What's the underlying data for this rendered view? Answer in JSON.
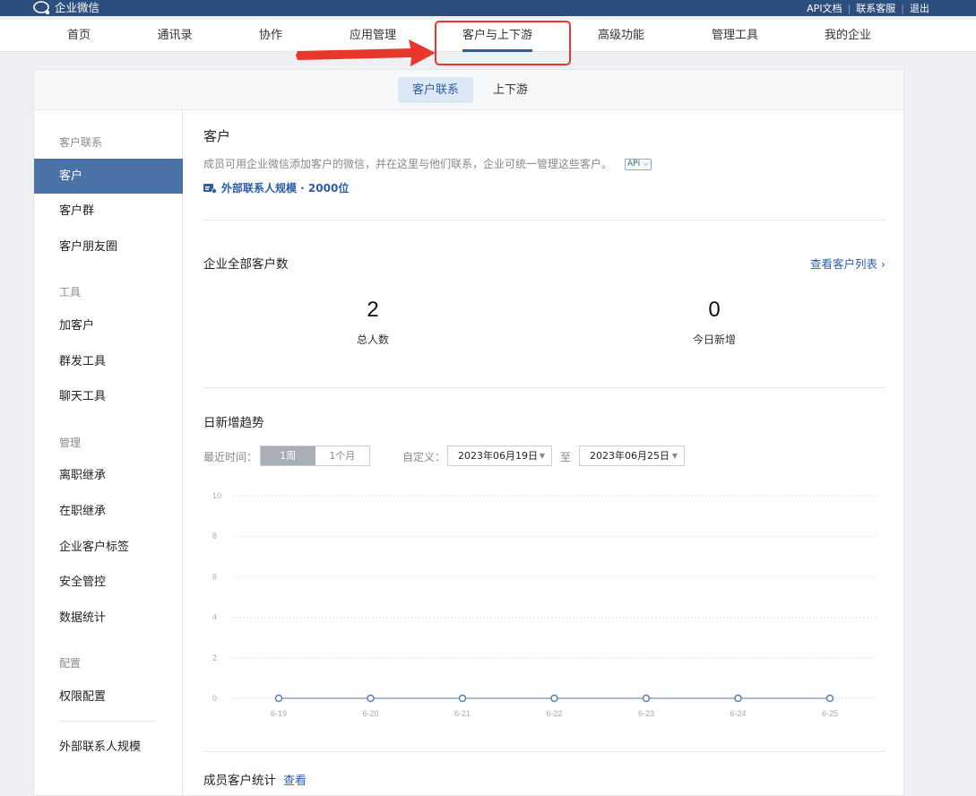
{
  "topbar": {
    "brand": "企业微信",
    "links": [
      "API文档",
      "联系客服",
      "退出"
    ]
  },
  "nav": {
    "items": [
      "首页",
      "通讯录",
      "协作",
      "应用管理",
      "客户与上下游",
      "高级功能",
      "管理工具",
      "我的企业"
    ],
    "active": "客户与上下游"
  },
  "subtabs": [
    "客户联系",
    "上下游"
  ],
  "sidebar": {
    "groups": [
      {
        "title": "客户联系",
        "items": [
          "客户",
          "客户群",
          "客户朋友圈"
        ]
      },
      {
        "title": "工具",
        "items": [
          "加客户",
          "群发工具",
          "聊天工具"
        ]
      },
      {
        "title": "管理",
        "items": [
          "离职继承",
          "在职继承",
          "企业客户标签",
          "安全管控",
          "数据统计"
        ]
      },
      {
        "title": "配置",
        "items": [
          "权限配置"
        ]
      }
    ],
    "footer_item": "外部联系人规模",
    "active": "客户"
  },
  "content": {
    "title": "客户",
    "description": "成员可用企业微信添加客户的微信，并在这里与他们联系，企业可统一管理这些客户。",
    "api_badge": "API",
    "scale_text": "外部联系人规模 · 2000位",
    "total_section_title": "企业全部客户数",
    "view_list": "查看客户列表",
    "stats": [
      {
        "value": "2",
        "label": "总人数"
      },
      {
        "value": "0",
        "label": "今日新增"
      }
    ],
    "trend_title": "日新增趋势",
    "recent_label": "最近时间：",
    "period_options": [
      "1周",
      "1个月"
    ],
    "period_selected": "1周",
    "custom_label": "自定义：",
    "date_from": "2023年06月19日",
    "to_label": "至",
    "date_to": "2023年06月25日",
    "member_stats_title": "成员客户统计",
    "member_stats_link": "查看"
  },
  "chart_data": {
    "type": "line",
    "x": [
      "6-19",
      "6-20",
      "6-21",
      "6-22",
      "6-23",
      "6-24",
      "6-25"
    ],
    "series": [
      {
        "values": [
          0,
          0,
          0,
          0,
          0,
          0,
          0
        ]
      }
    ],
    "ylim": [
      0,
      10
    ],
    "yticks": [
      0,
      2,
      4,
      6,
      8,
      10
    ],
    "grid": true,
    "line_color": "#8aa6c8"
  }
}
